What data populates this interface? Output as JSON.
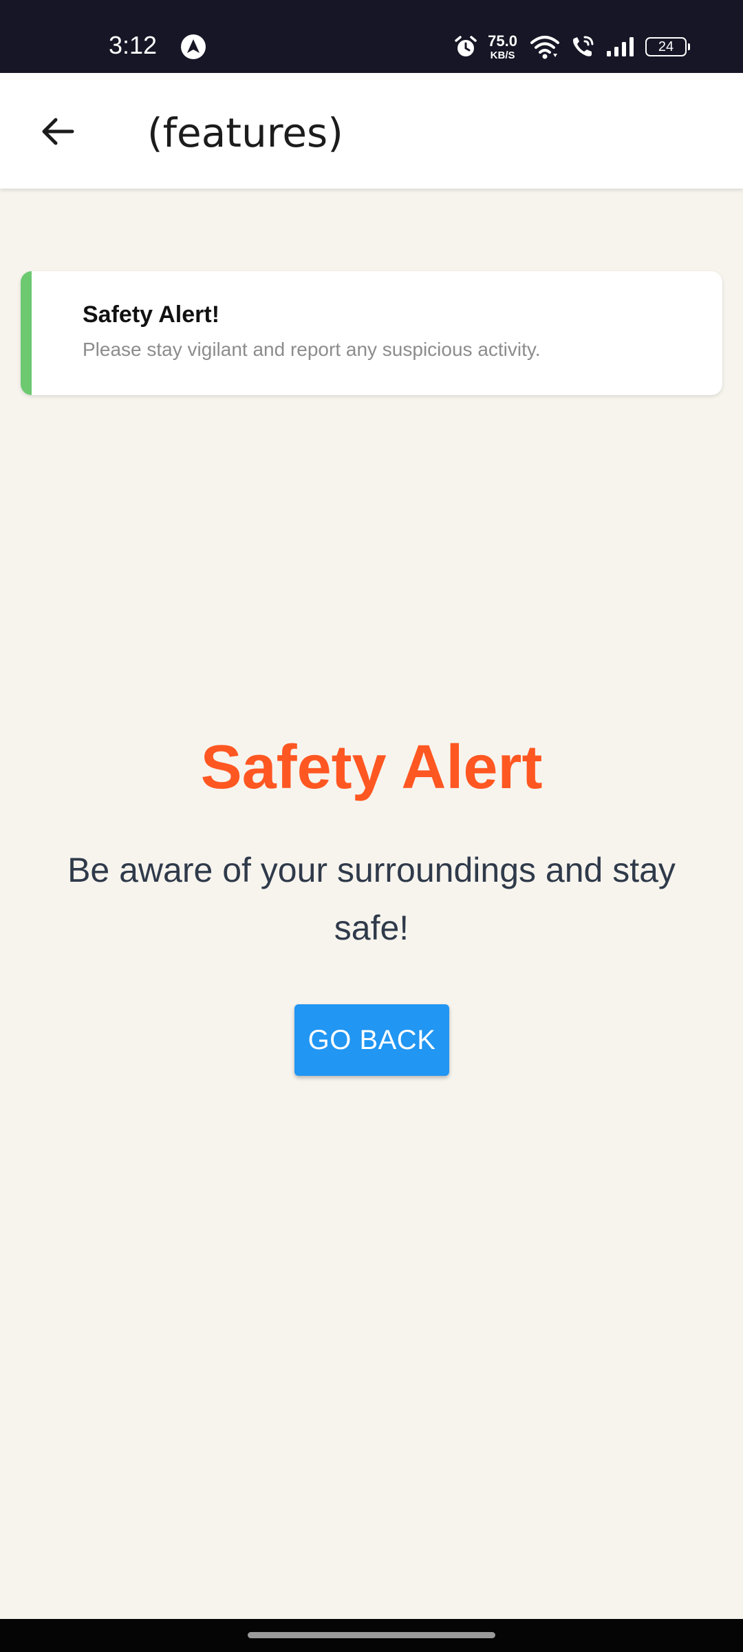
{
  "status_bar": {
    "time": "3:12",
    "app_icon": "nav-arrow-icon",
    "net_speed_value": "75.0",
    "net_speed_unit": "KB/S",
    "battery_level": "24",
    "icons": [
      "alarm-icon",
      "wifi-icon",
      "wifi-calling-icon",
      "signal-icon",
      "battery-icon"
    ]
  },
  "app_bar": {
    "back_icon": "arrow-left-icon",
    "title": "(features)"
  },
  "toast": {
    "title": "Safety Alert!",
    "message": "Please stay vigilant and report any suspicious activity.",
    "accent_color": "#6CC970"
  },
  "main": {
    "heading": "Safety Alert",
    "heading_color": "#FF5722",
    "message": "Be aware of your surroundings and stay safe!",
    "button_label": "GO BACK",
    "button_color": "#2196F3"
  }
}
